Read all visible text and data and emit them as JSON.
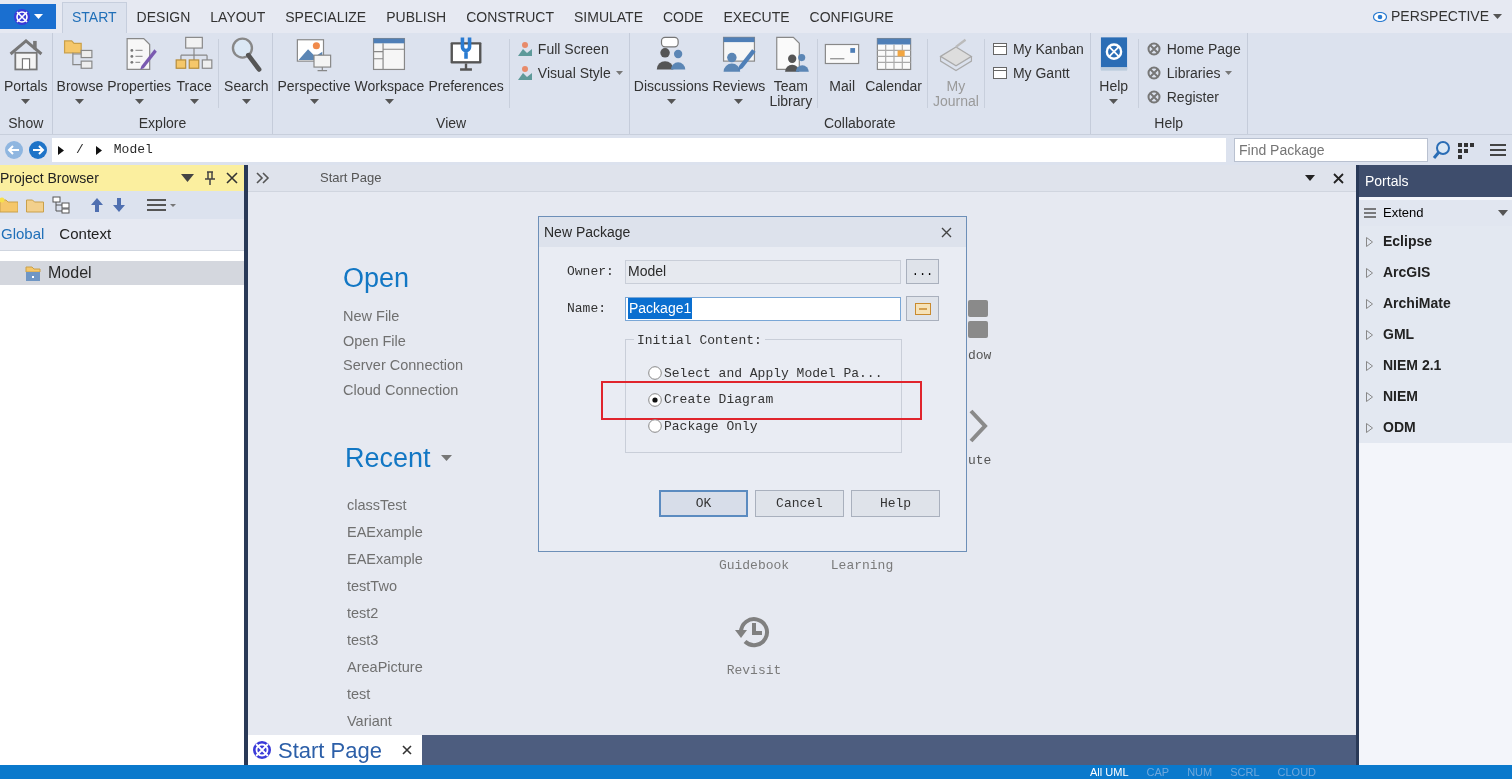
{
  "ribbon_tabs": [
    {
      "label": "START",
      "selected": true
    },
    {
      "label": "DESIGN",
      "selected": false
    },
    {
      "label": "LAYOUT",
      "selected": false
    },
    {
      "label": "SPECIALIZE",
      "selected": false
    },
    {
      "label": "PUBLISH",
      "selected": false
    },
    {
      "label": "CONSTRUCT",
      "selected": false
    },
    {
      "label": "SIMULATE",
      "selected": false
    },
    {
      "label": "CODE",
      "selected": false
    },
    {
      "label": "EXECUTE",
      "selected": false
    },
    {
      "label": "CONFIGURE",
      "selected": false
    }
  ],
  "perspective_menu": "PERSPECTIVE",
  "ribbon_groups": [
    {
      "label": "Show",
      "items": [
        {
          "kind": "large",
          "label": "Portals",
          "dropdown": true,
          "disabled": false
        }
      ]
    },
    {
      "label": "Explore",
      "items": [
        {
          "kind": "large",
          "label": "Browse",
          "dropdown": true,
          "disabled": false
        },
        {
          "kind": "large",
          "label": "Properties",
          "dropdown": true,
          "disabled": false
        },
        {
          "kind": "large",
          "label": "Trace",
          "dropdown": true,
          "disabled": false
        },
        {
          "kind": "separator"
        },
        {
          "kind": "large",
          "label": "Search",
          "dropdown": true,
          "disabled": false
        }
      ]
    },
    {
      "label": "View",
      "items": [
        {
          "kind": "large",
          "label": "Perspective",
          "dropdown": true,
          "disabled": false
        },
        {
          "kind": "large",
          "label": "Workspace",
          "dropdown": true,
          "disabled": false
        },
        {
          "kind": "large",
          "label": "Preferences",
          "dropdown": false,
          "disabled": false
        },
        {
          "kind": "separator"
        },
        {
          "kind": "stack",
          "entries": [
            {
              "label": "Full Screen",
              "dropdown": false
            },
            {
              "label": "Visual Style",
              "dropdown": true
            }
          ]
        }
      ]
    },
    {
      "label": "Collaborate",
      "items": [
        {
          "kind": "large",
          "label": "Discussions",
          "dropdown": true,
          "disabled": false
        },
        {
          "kind": "large",
          "label": "Reviews",
          "dropdown": true,
          "disabled": false
        },
        {
          "kind": "large",
          "label": "Team Library",
          "dropdown": false,
          "disabled": false
        },
        {
          "kind": "separator"
        },
        {
          "kind": "large",
          "label": "Mail",
          "dropdown": false,
          "disabled": false
        },
        {
          "kind": "large",
          "label": "Calendar",
          "dropdown": false,
          "disabled": false
        },
        {
          "kind": "separator"
        },
        {
          "kind": "large",
          "label": "My Journal",
          "dropdown": false,
          "disabled": true
        },
        {
          "kind": "separator"
        },
        {
          "kind": "stack",
          "entries": [
            {
              "label": "My Kanban",
              "dropdown": false
            },
            {
              "label": "My Gantt",
              "dropdown": false
            }
          ]
        }
      ]
    },
    {
      "label": "Help",
      "items": [
        {
          "kind": "large",
          "label": "Help",
          "dropdown": true,
          "disabled": false
        },
        {
          "kind": "separator"
        },
        {
          "kind": "stack",
          "entries": [
            {
              "label": "Home Page",
              "dropdown": false
            },
            {
              "label": "Libraries",
              "dropdown": true
            },
            {
              "label": "Register",
              "dropdown": false
            }
          ]
        }
      ]
    }
  ],
  "address_bar": {
    "path": [
      "/",
      "Model"
    ],
    "search": {
      "placeholder": "Find Package"
    }
  },
  "project_browser": {
    "title": "Project Browser",
    "tabs": [
      {
        "label": "Global",
        "selected": true
      },
      {
        "label": "Context",
        "selected": false
      }
    ],
    "tree": [
      {
        "label": "Model",
        "selected": true
      }
    ]
  },
  "document": {
    "title": "Start Page",
    "open": {
      "title": "Open",
      "links": [
        "New File",
        "Open File",
        "Server Connection",
        "Cloud Connection"
      ]
    },
    "recent": {
      "title": "Recent",
      "items": [
        "classTest",
        "EAExample",
        "EAExample",
        "testTwo",
        "test2",
        "test3",
        "AreaPicture",
        "test",
        "Variant"
      ]
    },
    "shortcuts": [
      {
        "label": "dow"
      },
      {
        "label": "ute"
      },
      {
        "label": "Guidebook"
      },
      {
        "label": "Learning"
      },
      {
        "label": "Revisit"
      }
    ],
    "tabs": [
      {
        "label": "Start Page",
        "selected": true
      }
    ]
  },
  "dialog": {
    "title": "New Package",
    "fields": [
      {
        "label": "Owner:",
        "value": "Model",
        "kind": "readonly",
        "button": "..."
      },
      {
        "label": "Name:",
        "value": "Package1",
        "kind": "editable"
      }
    ],
    "group_label": "Initial Content:",
    "options": [
      {
        "label": "Select and Apply Model Pa...",
        "selected": false,
        "highlighted": false
      },
      {
        "label": "Create Diagram",
        "selected": true,
        "highlighted": true
      },
      {
        "label": "Package Only",
        "selected": false,
        "highlighted": false
      }
    ],
    "buttons": [
      {
        "label": "OK",
        "default": true
      },
      {
        "label": "Cancel",
        "default": false
      },
      {
        "label": "Help",
        "default": false
      }
    ]
  },
  "portals": {
    "title": "Portals",
    "filter": "Extend",
    "items": [
      "Eclipse",
      "ArcGIS",
      "ArchiMate",
      "GML",
      "NIEM 2.1",
      "NIEM",
      "ODM"
    ]
  },
  "status_bar": {
    "items": [
      {
        "label": "All UML",
        "active": true
      },
      {
        "label": "CAP",
        "active": false
      },
      {
        "label": "NUM",
        "active": false
      },
      {
        "label": "SCRL",
        "active": false
      },
      {
        "label": "CLOUD",
        "active": false
      }
    ]
  }
}
